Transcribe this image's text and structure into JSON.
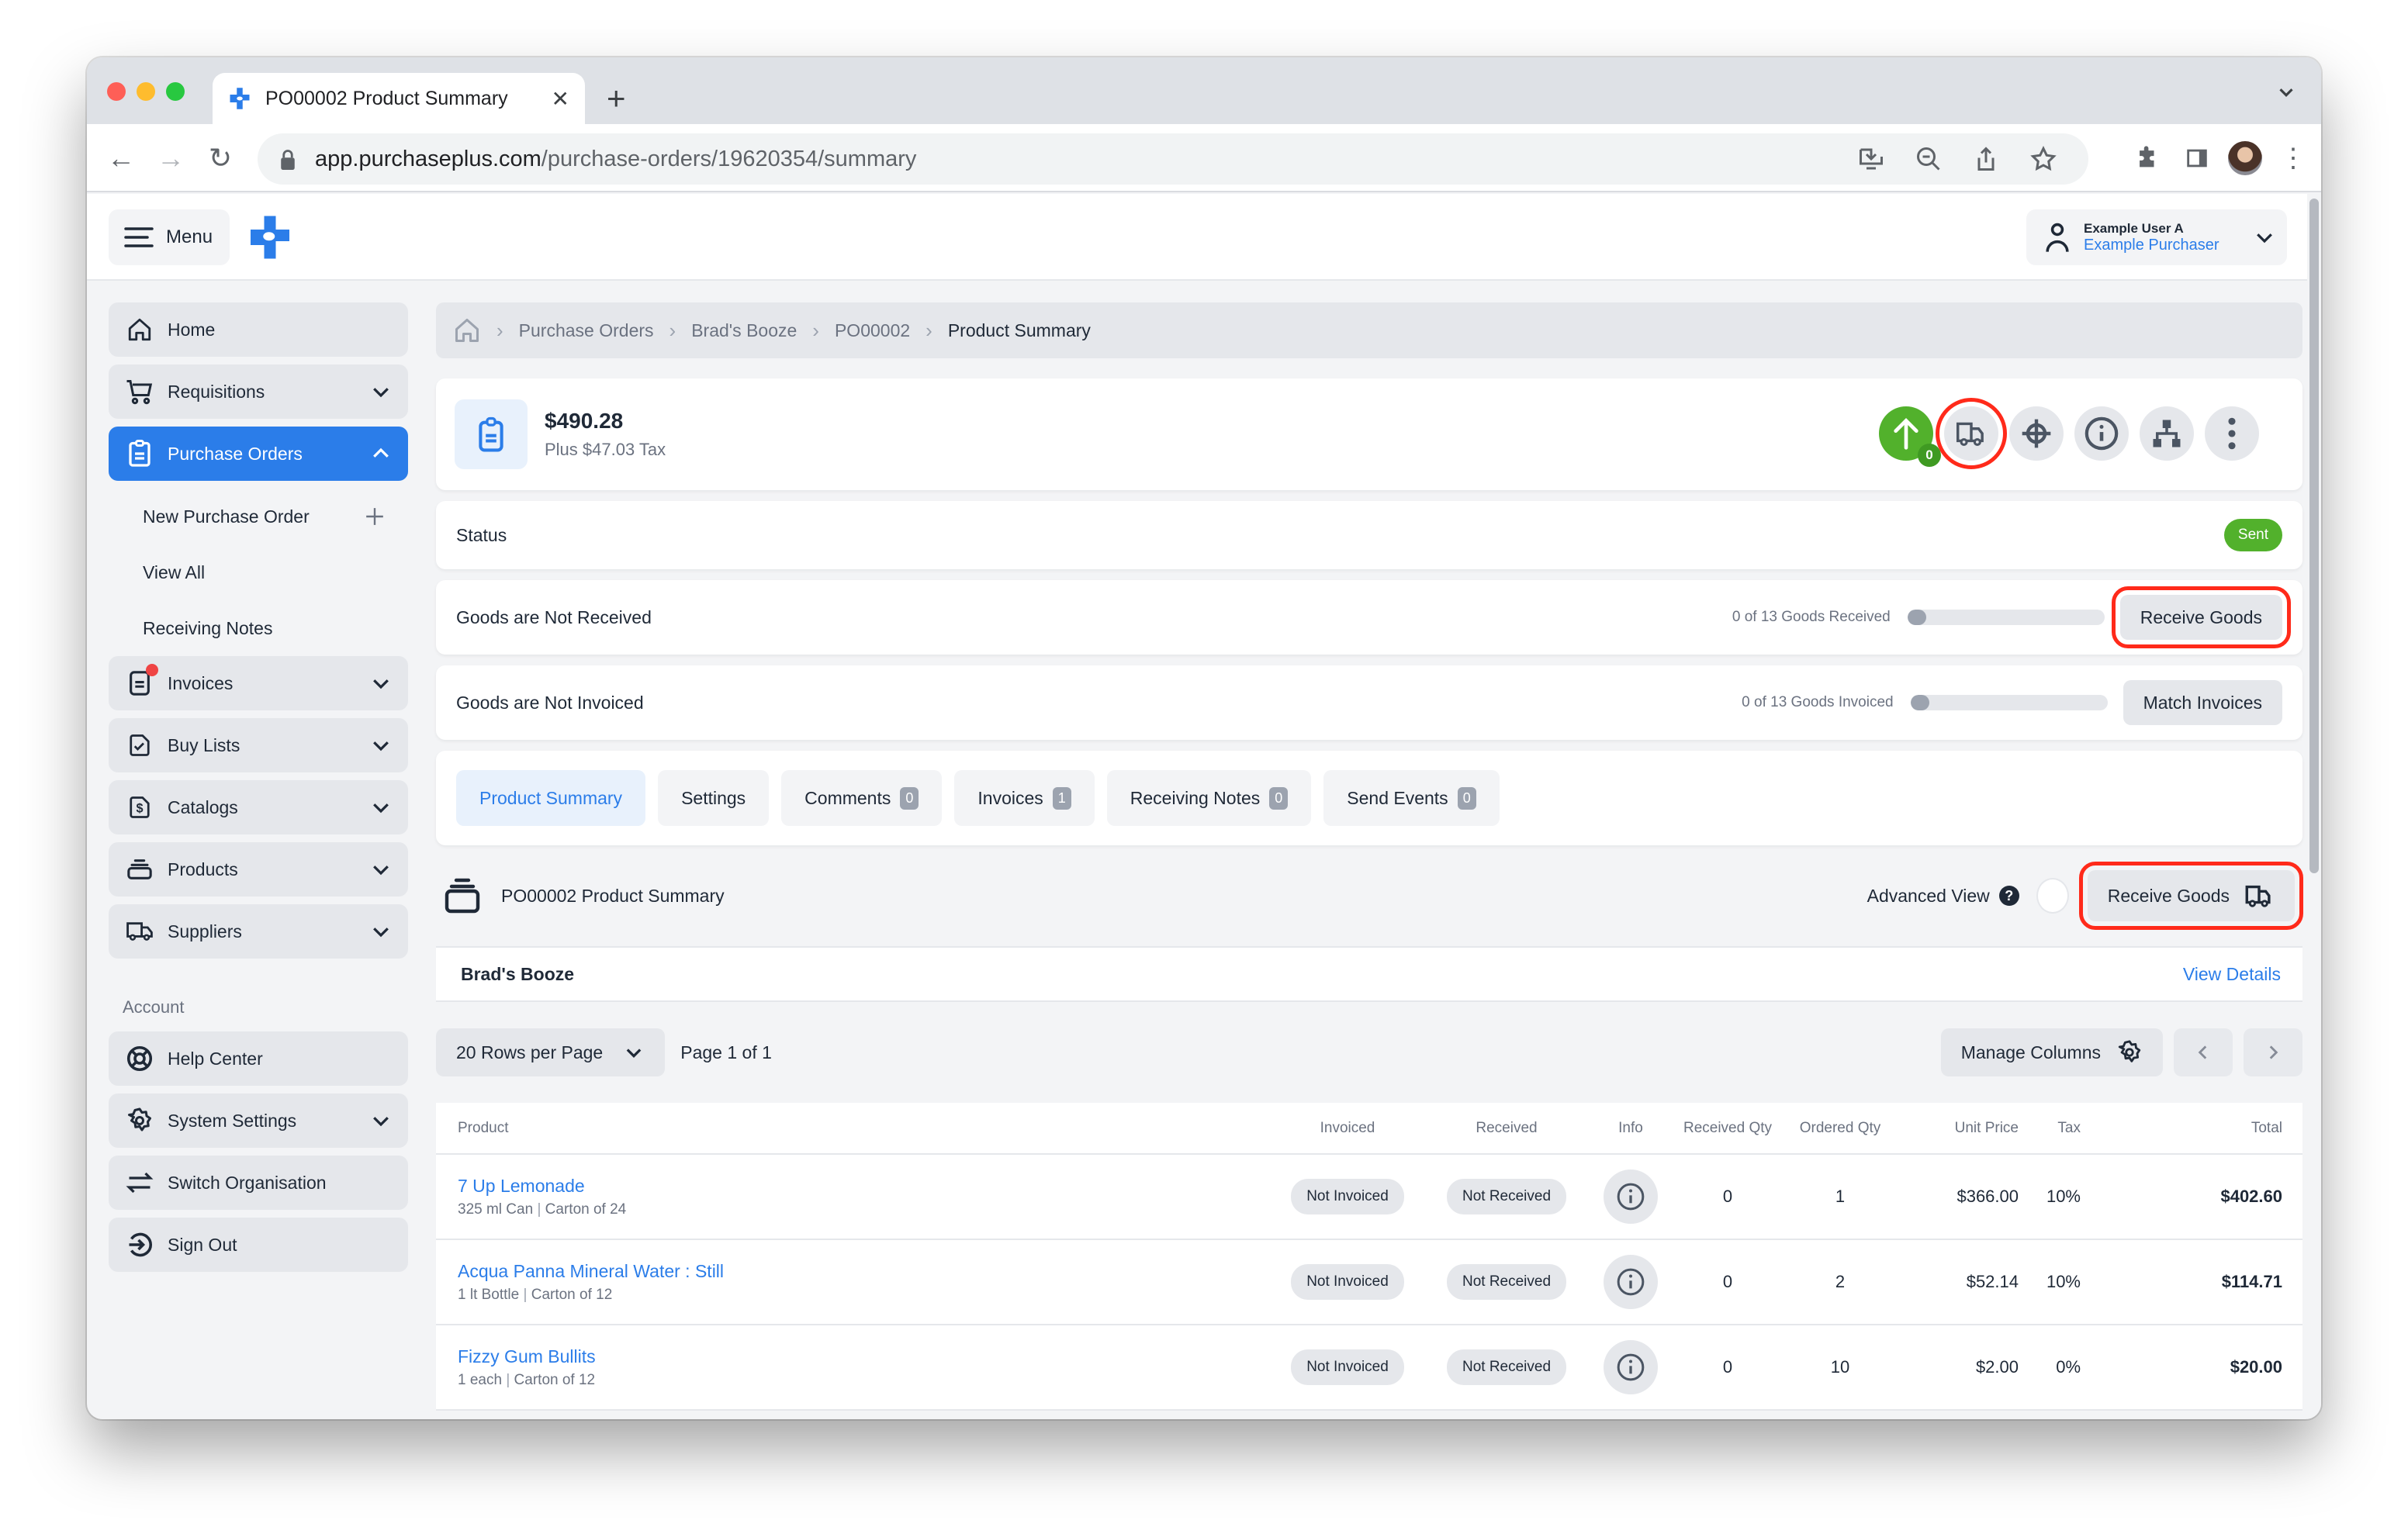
{
  "browser": {
    "tab_title": "PO00002 Product Summary",
    "url_host": "app.purchaseplus.com",
    "url_path": "/purchase-orders/19620354/summary"
  },
  "header": {
    "menu_label": "Menu",
    "user_name": "Example User A",
    "user_role": "Example Purchaser"
  },
  "sidebar": {
    "items": [
      {
        "label": "Home",
        "icon": "home-icon"
      },
      {
        "label": "Requisitions",
        "icon": "cart-icon"
      },
      {
        "label": "Purchase Orders",
        "icon": "clipboard-icon"
      },
      {
        "label": "Invoices",
        "icon": "document-icon"
      },
      {
        "label": "Buy Lists",
        "icon": "checklist-icon"
      },
      {
        "label": "Catalogs",
        "icon": "dollar-catalog-icon"
      },
      {
        "label": "Products",
        "icon": "products-icon"
      },
      {
        "label": "Suppliers",
        "icon": "truck-icon"
      }
    ],
    "sub_items": [
      "New Purchase Order",
      "View All",
      "Receiving Notes"
    ],
    "account_heading": "Account",
    "account_items": [
      {
        "label": "Help Center",
        "icon": "lifebuoy-icon"
      },
      {
        "label": "System Settings",
        "icon": "gear-icon"
      },
      {
        "label": "Switch Organisation",
        "icon": "switch-arrows-icon"
      },
      {
        "label": "Sign Out",
        "icon": "sign-out-icon"
      }
    ]
  },
  "breadcrumb": [
    "Purchase Orders",
    "Brad's Booze",
    "PO00002",
    "Product Summary"
  ],
  "summary": {
    "amount": "$490.28",
    "tax": "Plus $47.03 Tax",
    "approval_count": "0"
  },
  "status": {
    "label": "Status",
    "value": "Sent",
    "color": "#52b12c"
  },
  "received": {
    "label": "Goods are Not Received",
    "progress_text": "0 of 13 Goods Received",
    "progress_fraction": 0,
    "button": "Receive Goods"
  },
  "invoiced": {
    "label": "Goods are Not Invoiced",
    "progress_text": "0 of 13 Goods Invoiced",
    "progress_fraction": 0,
    "button": "Match Invoices"
  },
  "tabs": [
    {
      "label": "Product Summary",
      "count": null
    },
    {
      "label": "Settings",
      "count": null
    },
    {
      "label": "Comments",
      "count": "0"
    },
    {
      "label": "Invoices",
      "count": "1"
    },
    {
      "label": "Receiving Notes",
      "count": "0"
    },
    {
      "label": "Send Events",
      "count": "0"
    }
  ],
  "section": {
    "title": "PO00002 Product Summary",
    "advanced_view": "Advanced View",
    "receive_button": "Receive Goods"
  },
  "supplier": {
    "name": "Brad's Booze",
    "link": "View Details"
  },
  "pager": {
    "rows_per_page": "20 Rows per Page",
    "page_of": "Page 1 of 1",
    "manage_columns": "Manage Columns"
  },
  "table": {
    "headers": [
      "Product",
      "Invoiced",
      "Received",
      "Info",
      "Received Qty",
      "Ordered Qty",
      "Unit Price",
      "Tax",
      "Total"
    ],
    "rows": [
      {
        "name": "7 Up Lemonade",
        "size": "325 ml Can",
        "pack": "Carton of 24",
        "invoiced": "Not Invoiced",
        "received": "Not Received",
        "received_qty": "0",
        "ordered_qty": "1",
        "unit_price": "$366.00",
        "tax": "10%",
        "total": "$402.60"
      },
      {
        "name": "Acqua Panna Mineral Water : Still",
        "size": "1 lt Bottle",
        "pack": "Carton of 12",
        "invoiced": "Not Invoiced",
        "received": "Not Received",
        "received_qty": "0",
        "ordered_qty": "2",
        "unit_price": "$52.14",
        "tax": "10%",
        "total": "$114.71"
      },
      {
        "name": "Fizzy Gum Bullits",
        "size": "1 each",
        "pack": "Carton of 12",
        "invoiced": "Not Invoiced",
        "received": "Not Received",
        "received_qty": "0",
        "ordered_qty": "10",
        "unit_price": "$2.00",
        "tax": "0%",
        "total": "$20.00"
      }
    ]
  },
  "colors": {
    "brand": "#2b7de9",
    "success": "#52b12c",
    "highlight": "#ff2a1a"
  }
}
